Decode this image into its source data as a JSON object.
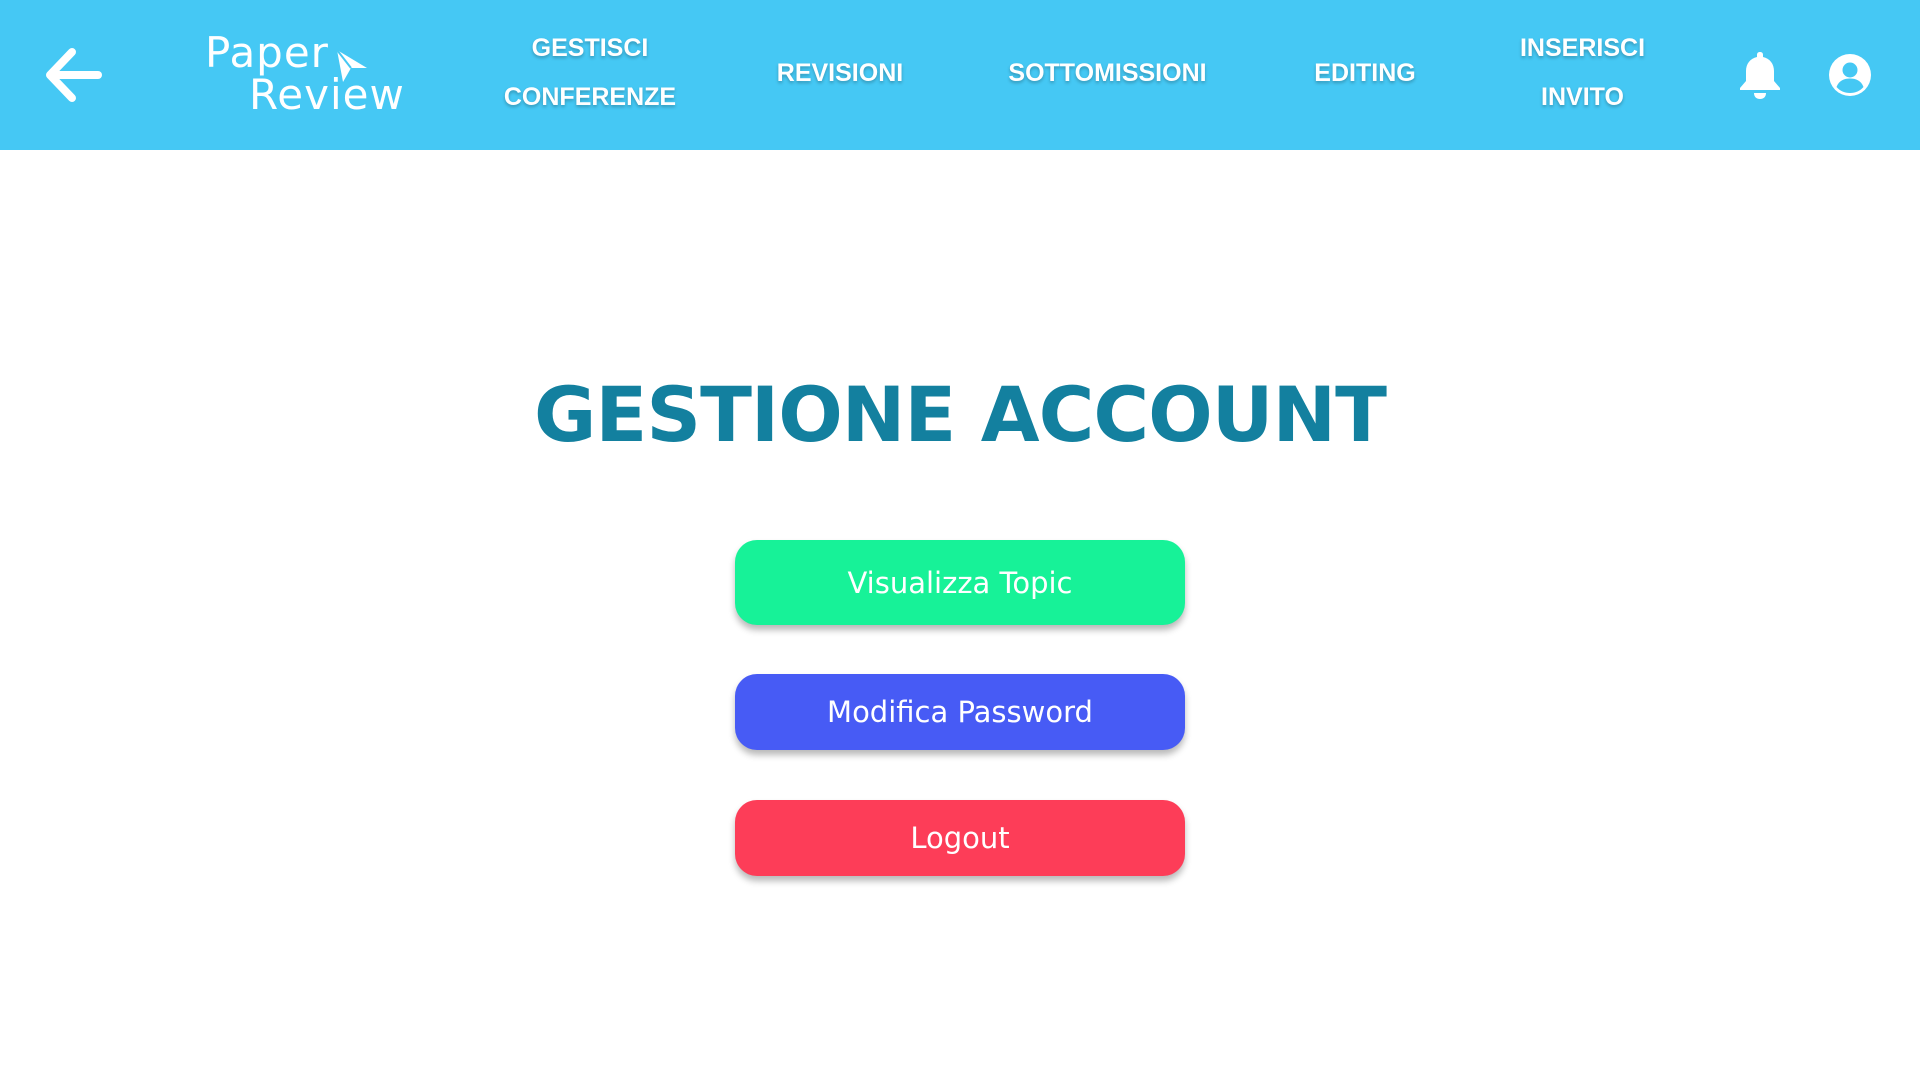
{
  "app": {
    "logo_line1": "Paper",
    "logo_line2": "Review"
  },
  "nav": {
    "back_icon": "arrow-left-icon",
    "items": [
      {
        "line1": "GESTISCI",
        "line2": "CONFERENZE"
      },
      {
        "label": "REVISIONI"
      },
      {
        "label": "SOTTOMISSIONI"
      },
      {
        "label": "EDITING"
      },
      {
        "line1": "INSERISCI",
        "line2": "INVITO"
      }
    ],
    "notification_icon": "bell-icon",
    "account_icon": "user-circle-icon"
  },
  "main": {
    "title": "GESTIONE ACCOUNT",
    "buttons": [
      {
        "label": "Visualizza Topic",
        "color": "#17f298"
      },
      {
        "label": "Modifica Password",
        "color": "#475bf5"
      },
      {
        "label": "Logout",
        "color": "#fd3d58"
      }
    ]
  },
  "colors": {
    "header": "#45c8f4",
    "title": "#13809f"
  }
}
